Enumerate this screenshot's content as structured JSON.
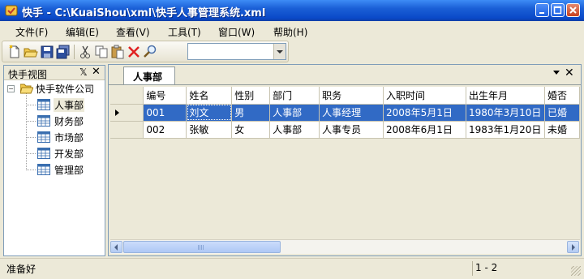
{
  "window": {
    "title": "快手 - C:\\KuaiShou\\xml\\快手人事管理系统.xml"
  },
  "menu": [
    "文件(F)",
    "编辑(E)",
    "查看(V)",
    "工具(T)",
    "窗口(W)",
    "帮助(H)"
  ],
  "toolbar": {
    "icons": [
      "new-file-icon",
      "open-folder-icon",
      "save-icon",
      "save-all-icon",
      "cut-icon",
      "copy-icon",
      "paste-icon",
      "delete-icon",
      "find-icon"
    ],
    "combo_value": ""
  },
  "left_panel": {
    "title": "快手视图",
    "root": "快手软件公司",
    "items": [
      "人事部",
      "财务部",
      "市场部",
      "开发部",
      "管理部"
    ],
    "selected_index": 0
  },
  "document": {
    "tab_label": "人事部",
    "columns": [
      "编号",
      "姓名",
      "性别",
      "部门",
      "职务",
      "入职时间",
      "出生年月",
      "婚否"
    ],
    "rows": [
      [
        "001",
        "刘文",
        "男",
        "人事部",
        "人事经理",
        "2008年5月1日",
        "1980年3月10日",
        "已婚"
      ],
      [
        "002",
        "张敏",
        "女",
        "人事部",
        "人事专员",
        "2008年6月1日",
        "1983年1月20日",
        "未婚"
      ]
    ],
    "selected_row": 0
  },
  "status": {
    "text": "准备好",
    "count": "1 - 2"
  },
  "colors": {
    "titlebar": "#0a49c8",
    "selection": "#316ac5",
    "chrome": "#ece9d8"
  }
}
